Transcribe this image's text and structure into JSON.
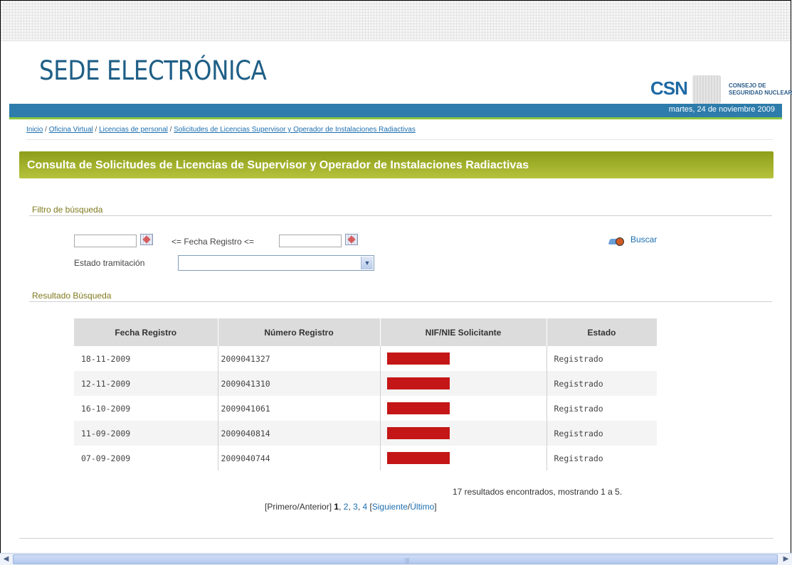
{
  "header": {
    "site_title": "SEDE ELECTRÓNICA",
    "logo_acronym": "CSN",
    "logo_line1": "CONSEJO DE",
    "logo_line2": "SEGURIDAD NUCLEAR",
    "date": "martes, 24 de noviembre 2009"
  },
  "breadcrumb": {
    "items": [
      "Inicio",
      "Oficina Virtual",
      "Licencias de personal",
      "Solicitudes de Licencias Supervisor y Operador de Instalaciones Radiactivas"
    ],
    "separator": " / "
  },
  "page": {
    "title": "Consulta de Solicitudes de Licencias de Supervisor y Operador de Instalaciones Radiactivas"
  },
  "filter": {
    "section_label": "Filtro de búsqueda",
    "date_from_value": "",
    "date_to_value": "",
    "date_label": "<= Fecha Registro <=",
    "status_label": "Estado tramitación",
    "status_selected": "",
    "search_label": "Buscar"
  },
  "results": {
    "section_label": "Resultado Búsqueda",
    "columns": [
      "Fecha Registro",
      "Número Registro",
      "NIF/NIE Solicitante",
      "Estado"
    ],
    "rows": [
      {
        "fecha": "18-11-2009",
        "numero": "2009041327",
        "estado": "Registrado"
      },
      {
        "fecha": "12-11-2009",
        "numero": "2009041310",
        "estado": "Registrado"
      },
      {
        "fecha": "16-10-2009",
        "numero": "2009041061",
        "estado": "Registrado"
      },
      {
        "fecha": "11-09-2009",
        "numero": "2009040814",
        "estado": "Registrado"
      },
      {
        "fecha": "07-09-2009",
        "numero": "2009040744",
        "estado": "Registrado"
      }
    ],
    "summary": "17 resultados encontrados, mostrando 1 a 5.",
    "pager": {
      "open_bracket": "[",
      "first": "Primero",
      "slash": "/",
      "prev": "Anterior",
      "close_bracket": "]",
      "current": "1",
      "pages": [
        "2",
        "3",
        "4"
      ],
      "next": "Siguiente",
      "last": "Último"
    }
  },
  "colors": {
    "brand_blue": "#2d7cab",
    "brand_green": "#8cc63e",
    "title_olive": "#9aa82a",
    "redaction": "#c41616",
    "link": "#1d6fb0"
  },
  "icons": [
    "calendar-icon",
    "search-icon",
    "chevron-down-icon",
    "scroll-left-icon",
    "scroll-right-icon"
  ]
}
